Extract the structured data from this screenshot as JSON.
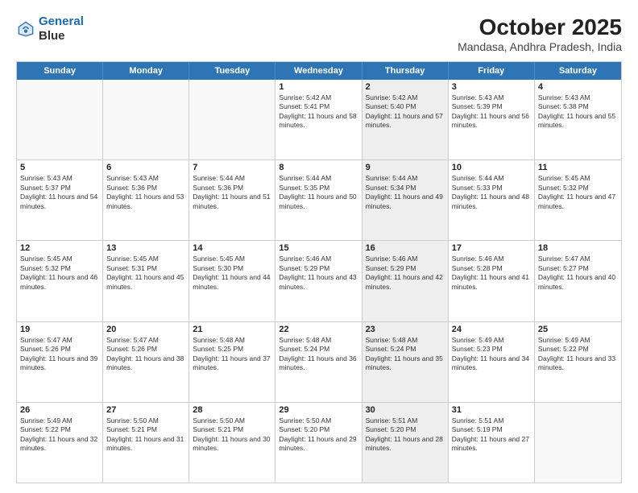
{
  "header": {
    "logo_line1": "General",
    "logo_line2": "Blue",
    "title": "October 2025",
    "subtitle": "Mandasa, Andhra Pradesh, India"
  },
  "days_of_week": [
    "Sunday",
    "Monday",
    "Tuesday",
    "Wednesday",
    "Thursday",
    "Friday",
    "Saturday"
  ],
  "weeks": [
    [
      {
        "day": "",
        "sunrise": "",
        "sunset": "",
        "daylight": "",
        "shaded": false
      },
      {
        "day": "",
        "sunrise": "",
        "sunset": "",
        "daylight": "",
        "shaded": false
      },
      {
        "day": "",
        "sunrise": "",
        "sunset": "",
        "daylight": "",
        "shaded": false
      },
      {
        "day": "1",
        "sunrise": "Sunrise: 5:42 AM",
        "sunset": "Sunset: 5:41 PM",
        "daylight": "Daylight: 11 hours and 58 minutes.",
        "shaded": false
      },
      {
        "day": "2",
        "sunrise": "Sunrise: 5:42 AM",
        "sunset": "Sunset: 5:40 PM",
        "daylight": "Daylight: 11 hours and 57 minutes.",
        "shaded": true
      },
      {
        "day": "3",
        "sunrise": "Sunrise: 5:43 AM",
        "sunset": "Sunset: 5:39 PM",
        "daylight": "Daylight: 11 hours and 56 minutes.",
        "shaded": false
      },
      {
        "day": "4",
        "sunrise": "Sunrise: 5:43 AM",
        "sunset": "Sunset: 5:38 PM",
        "daylight": "Daylight: 11 hours and 55 minutes.",
        "shaded": false
      }
    ],
    [
      {
        "day": "5",
        "sunrise": "Sunrise: 5:43 AM",
        "sunset": "Sunset: 5:37 PM",
        "daylight": "Daylight: 11 hours and 54 minutes.",
        "shaded": false
      },
      {
        "day": "6",
        "sunrise": "Sunrise: 5:43 AM",
        "sunset": "Sunset: 5:36 PM",
        "daylight": "Daylight: 11 hours and 53 minutes.",
        "shaded": false
      },
      {
        "day": "7",
        "sunrise": "Sunrise: 5:44 AM",
        "sunset": "Sunset: 5:36 PM",
        "daylight": "Daylight: 11 hours and 51 minutes.",
        "shaded": false
      },
      {
        "day": "8",
        "sunrise": "Sunrise: 5:44 AM",
        "sunset": "Sunset: 5:35 PM",
        "daylight": "Daylight: 11 hours and 50 minutes.",
        "shaded": false
      },
      {
        "day": "9",
        "sunrise": "Sunrise: 5:44 AM",
        "sunset": "Sunset: 5:34 PM",
        "daylight": "Daylight: 11 hours and 49 minutes.",
        "shaded": true
      },
      {
        "day": "10",
        "sunrise": "Sunrise: 5:44 AM",
        "sunset": "Sunset: 5:33 PM",
        "daylight": "Daylight: 11 hours and 48 minutes.",
        "shaded": false
      },
      {
        "day": "11",
        "sunrise": "Sunrise: 5:45 AM",
        "sunset": "Sunset: 5:32 PM",
        "daylight": "Daylight: 11 hours and 47 minutes.",
        "shaded": false
      }
    ],
    [
      {
        "day": "12",
        "sunrise": "Sunrise: 5:45 AM",
        "sunset": "Sunset: 5:32 PM",
        "daylight": "Daylight: 11 hours and 46 minutes.",
        "shaded": false
      },
      {
        "day": "13",
        "sunrise": "Sunrise: 5:45 AM",
        "sunset": "Sunset: 5:31 PM",
        "daylight": "Daylight: 11 hours and 45 minutes.",
        "shaded": false
      },
      {
        "day": "14",
        "sunrise": "Sunrise: 5:45 AM",
        "sunset": "Sunset: 5:30 PM",
        "daylight": "Daylight: 11 hours and 44 minutes.",
        "shaded": false
      },
      {
        "day": "15",
        "sunrise": "Sunrise: 5:46 AM",
        "sunset": "Sunset: 5:29 PM",
        "daylight": "Daylight: 11 hours and 43 minutes.",
        "shaded": false
      },
      {
        "day": "16",
        "sunrise": "Sunrise: 5:46 AM",
        "sunset": "Sunset: 5:29 PM",
        "daylight": "Daylight: 11 hours and 42 minutes.",
        "shaded": true
      },
      {
        "day": "17",
        "sunrise": "Sunrise: 5:46 AM",
        "sunset": "Sunset: 5:28 PM",
        "daylight": "Daylight: 11 hours and 41 minutes.",
        "shaded": false
      },
      {
        "day": "18",
        "sunrise": "Sunrise: 5:47 AM",
        "sunset": "Sunset: 5:27 PM",
        "daylight": "Daylight: 11 hours and 40 minutes.",
        "shaded": false
      }
    ],
    [
      {
        "day": "19",
        "sunrise": "Sunrise: 5:47 AM",
        "sunset": "Sunset: 5:26 PM",
        "daylight": "Daylight: 11 hours and 39 minutes.",
        "shaded": false
      },
      {
        "day": "20",
        "sunrise": "Sunrise: 5:47 AM",
        "sunset": "Sunset: 5:26 PM",
        "daylight": "Daylight: 11 hours and 38 minutes.",
        "shaded": false
      },
      {
        "day": "21",
        "sunrise": "Sunrise: 5:48 AM",
        "sunset": "Sunset: 5:25 PM",
        "daylight": "Daylight: 11 hours and 37 minutes.",
        "shaded": false
      },
      {
        "day": "22",
        "sunrise": "Sunrise: 5:48 AM",
        "sunset": "Sunset: 5:24 PM",
        "daylight": "Daylight: 11 hours and 36 minutes.",
        "shaded": false
      },
      {
        "day": "23",
        "sunrise": "Sunrise: 5:48 AM",
        "sunset": "Sunset: 5:24 PM",
        "daylight": "Daylight: 11 hours and 35 minutes.",
        "shaded": true
      },
      {
        "day": "24",
        "sunrise": "Sunrise: 5:49 AM",
        "sunset": "Sunset: 5:23 PM",
        "daylight": "Daylight: 11 hours and 34 minutes.",
        "shaded": false
      },
      {
        "day": "25",
        "sunrise": "Sunrise: 5:49 AM",
        "sunset": "Sunset: 5:22 PM",
        "daylight": "Daylight: 11 hours and 33 minutes.",
        "shaded": false
      }
    ],
    [
      {
        "day": "26",
        "sunrise": "Sunrise: 5:49 AM",
        "sunset": "Sunset: 5:22 PM",
        "daylight": "Daylight: 11 hours and 32 minutes.",
        "shaded": false
      },
      {
        "day": "27",
        "sunrise": "Sunrise: 5:50 AM",
        "sunset": "Sunset: 5:21 PM",
        "daylight": "Daylight: 11 hours and 31 minutes.",
        "shaded": false
      },
      {
        "day": "28",
        "sunrise": "Sunrise: 5:50 AM",
        "sunset": "Sunset: 5:21 PM",
        "daylight": "Daylight: 11 hours and 30 minutes.",
        "shaded": false
      },
      {
        "day": "29",
        "sunrise": "Sunrise: 5:50 AM",
        "sunset": "Sunset: 5:20 PM",
        "daylight": "Daylight: 11 hours and 29 minutes.",
        "shaded": false
      },
      {
        "day": "30",
        "sunrise": "Sunrise: 5:51 AM",
        "sunset": "Sunset: 5:20 PM",
        "daylight": "Daylight: 11 hours and 28 minutes.",
        "shaded": true
      },
      {
        "day": "31",
        "sunrise": "Sunrise: 5:51 AM",
        "sunset": "Sunset: 5:19 PM",
        "daylight": "Daylight: 11 hours and 27 minutes.",
        "shaded": false
      },
      {
        "day": "",
        "sunrise": "",
        "sunset": "",
        "daylight": "",
        "shaded": false
      }
    ]
  ]
}
